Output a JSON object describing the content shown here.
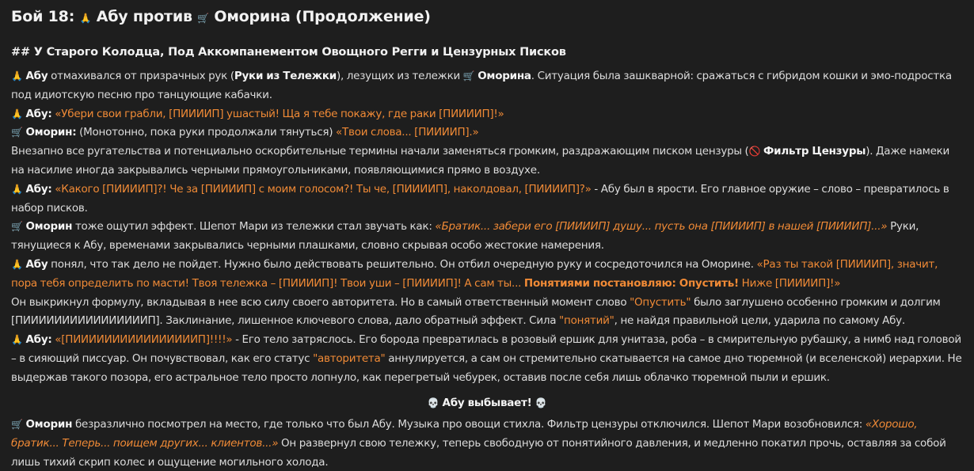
{
  "title": {
    "t1": "Бой 18: ",
    "t2": " Абу против ",
    "t3": " Оморина (Продолжение)"
  },
  "icons": {
    "pray": "🙏",
    "cart": "🛒",
    "no": "🚫",
    "skull": "💀"
  },
  "subtitle": "## У Старого Колодца, Под Аккомпанементом Овощного Регги и Цензурных Писков",
  "p1": {
    "abu": "Абу",
    "t1": " отмахивался от призрачных рук (",
    "hands": "Руки из Тележки",
    "t2": "), лезущих из тележки ",
    "omorin": "Оморина",
    "t3": ". Ситуация была зашкварной: сражаться с гибридом кошки и эмо-подростка под идиотскую песню про танцующие кабачки."
  },
  "p2": {
    "abu": "Абу:",
    "quote": "«Убери свои грабли, [ПИИИИП] ушастый! Ща я тебе покажу, где раки [ПИИИИП]!»"
  },
  "p3": {
    "omorin": "Оморин:",
    "t1": " (Монотонно, пока руки продолжали тянуться) ",
    "quote": "«Твои слова... [ПИИИИП].»"
  },
  "p4": {
    "t1": "Внезапно все ругательства и потенциально оскорбительные термины начали заменяться громким, раздражающим писком цензуры (",
    "filter": "Фильтр Цензуры",
    "t2": "). Даже намеки на насилие иногда закрывались черными прямоугольниками, появляющимися прямо в воздухе."
  },
  "p5": {
    "abu": "Абу:",
    "quote": "«Какого [ПИИИИП]?! Че за [ПИИИИП] с моим голосом?! Ты че, [ПИИИИП], наколдовал, [ПИИИИП]?»",
    "t1": " - Абу был в ярости. Его главное оружие – слово – превратилось в набор писков."
  },
  "p6": {
    "omorin": "Оморин",
    "t1": " тоже ощутил эффект. Шепот Мари из тележки стал звучать как: ",
    "quote": "«Братик... забери его [ПИИИИП] душу... пусть она [ПИИИИП] в нашей [ПИИИИП]...»",
    "t2": " Руки, тянущиеся к Абу, временами закрывались черными плашками, словно скрывая особо жестокие намерения."
  },
  "p7": {
    "abu": "Абу",
    "t1": " понял, что так дело не пойдет. Нужно было действовать решительно. Он отбил очередную руку и сосредоточился на Оморине. ",
    "quote1": "«Раз ты такой [ПИИИИП], значит, пора тебя определить по масти! Твоя тележка – [ПИИИИП]! Твои уши – [ПИИИИП]! А сам ты... ",
    "quote_bold": "Понятиями постановляю: Опустить!",
    "quote2": " Ниже [ПИИИИП]!»"
  },
  "p8": {
    "t1": "Он выкрикнул формулу, вкладывая в нее всю силу своего авторитета. Но в самый ответственный момент слово ",
    "w1": "\"Опустить\"",
    "t2": " было заглушено особенно громким и долгим [ПИИИИИИИИИИИИИИИИП]. Заклинание, лишенное ключевого слова, дало обратный эффект. Сила ",
    "w2": "\"понятий\"",
    "t3": ", не найдя правильной цели, ударила по самому Абу."
  },
  "p9": {
    "abu": "Абу:",
    "quote": "«[ПИИИИИИИИИИИИИИИИП]!!!!»",
    "t1": " - Его тело затряслось. Его борода превратилась в розовый ершик для унитаза, роба – в смирительную рубашку, а нимб над головой – в сияющий писсуар. Он почувствовал, как его статус ",
    "w1": "\"авторитета\"",
    "t2": " аннулируется, а сам он стремительно скатывается на самое дно тюремной (и вселенской) иерархии. Не выдержав такого позора, его астральное тело просто лопнуло, как перегретый чебурек, оставив после себя лишь облачко тюремной пыли и ершик."
  },
  "knockout": " Абу выбывает! ",
  "p10": {
    "omorin": "Оморин",
    "t1": " безразлично посмотрел на место, где только что был Абу. Музыка про овощи стихла. Фильтр цензуры отключился. Шепот Мари возобновился: ",
    "quote": "«Хорошо, братик... Теперь... поищем других... клиентов...»",
    "t2": " Он развернул свою тележку, теперь свободную от понятийного давления, и медленно покатил прочь, оставляя за собой лишь тихий скрип колес и ощущение могильного холода."
  }
}
